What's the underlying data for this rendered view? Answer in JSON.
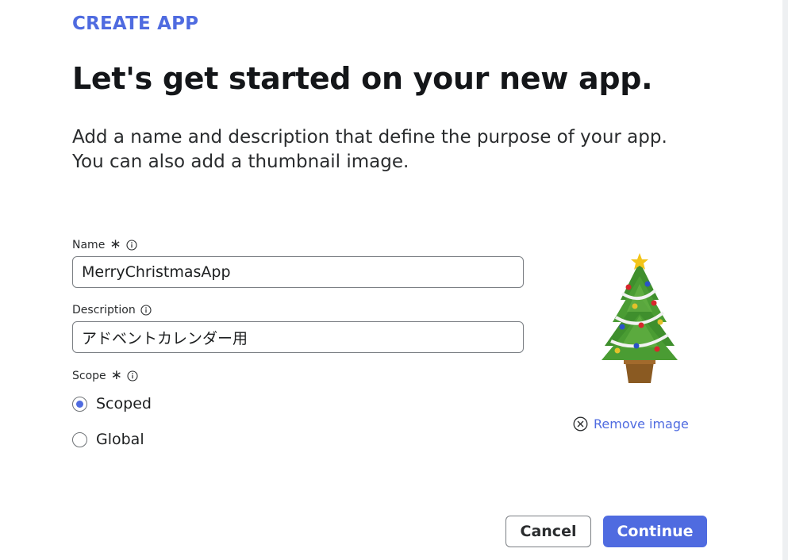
{
  "header": {
    "eyebrow": "CREATE APP",
    "title": "Let's get started on your new app.",
    "subtitle_line1": "Add a name and description that define the purpose of your app.",
    "subtitle_line2": "You can also add a thumbnail image."
  },
  "form": {
    "name": {
      "label": "Name",
      "required_mark": "∗",
      "value": "MerryChristmasApp"
    },
    "description": {
      "label": "Description",
      "value": "アドベントカレンダー用"
    },
    "scope": {
      "label": "Scope",
      "required_mark": "∗",
      "options": [
        {
          "label": "Scoped",
          "selected": true
        },
        {
          "label": "Global",
          "selected": false
        }
      ]
    }
  },
  "thumbnail": {
    "icon": "christmas-tree-image",
    "remove_label": "Remove image"
  },
  "actions": {
    "cancel_label": "Cancel",
    "continue_label": "Continue"
  },
  "colors": {
    "accent": "#4f6be0",
    "text": "#1d1f20",
    "border": "#7b7f84"
  }
}
